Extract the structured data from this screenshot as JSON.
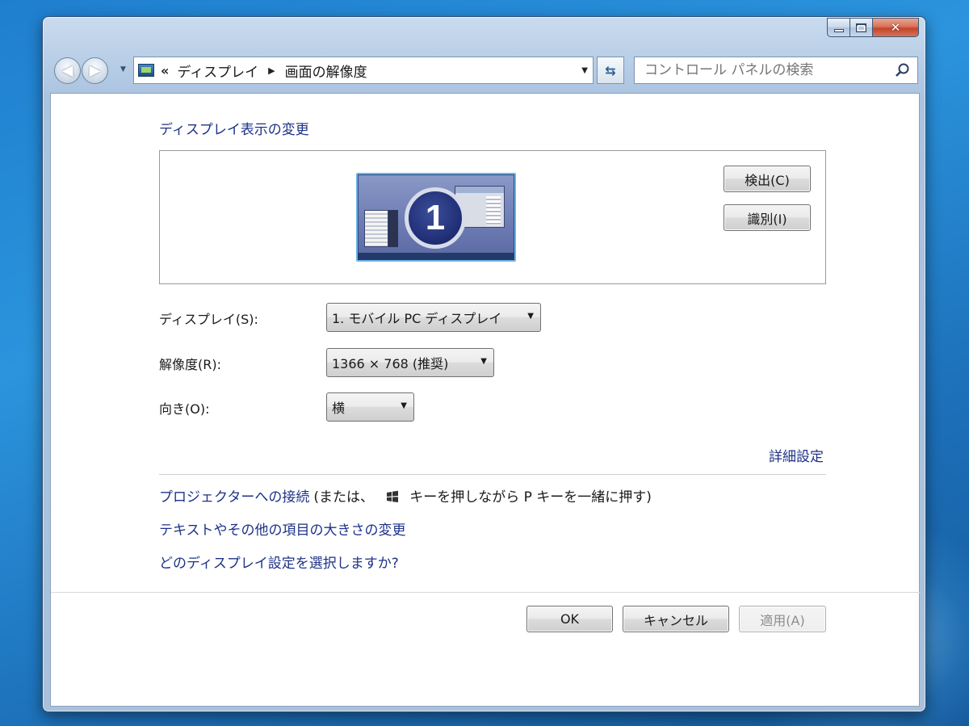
{
  "address_bar": {
    "overflow": "«",
    "crumbs": [
      "ディスプレイ",
      "画面の解像度"
    ]
  },
  "search": {
    "placeholder": "コントロール パネルの検索"
  },
  "icons": {
    "back": "back-arrow-icon",
    "forward": "forward-arrow-icon",
    "refresh": "refresh-icon",
    "search": "search-icon",
    "windows_key": "windows-logo-icon"
  },
  "page_title": "ディスプレイ表示の変更",
  "preview": {
    "monitor_number": "1",
    "detect_label": "検出(C)",
    "identify_label": "識別(I)"
  },
  "fields": {
    "display": {
      "label": "ディスプレイ(S):",
      "value": "1. モバイル PC ディスプレイ"
    },
    "resolution": {
      "label": "解像度(R):",
      "value": "1366 × 768 (推奨)"
    },
    "orientation": {
      "label": "向き(O):",
      "value": "横"
    }
  },
  "advanced_link": "詳細設定",
  "links": {
    "projector": "プロジェクターへの接続",
    "projector_note_prefix": "(または、",
    "projector_note_suffix": "キーを押しながら P キーを一緒に押す)",
    "text_size": "テキストやその他の項目の大きさの変更",
    "which_settings": "どのディスプレイ設定を選択しますか?"
  },
  "buttons": {
    "ok": "OK",
    "cancel": "キャンセル",
    "apply": "適用(A)"
  },
  "colors": {
    "link": "#1e3287",
    "title_bar": "#b7cde6",
    "desktop": "#2b94dd"
  }
}
